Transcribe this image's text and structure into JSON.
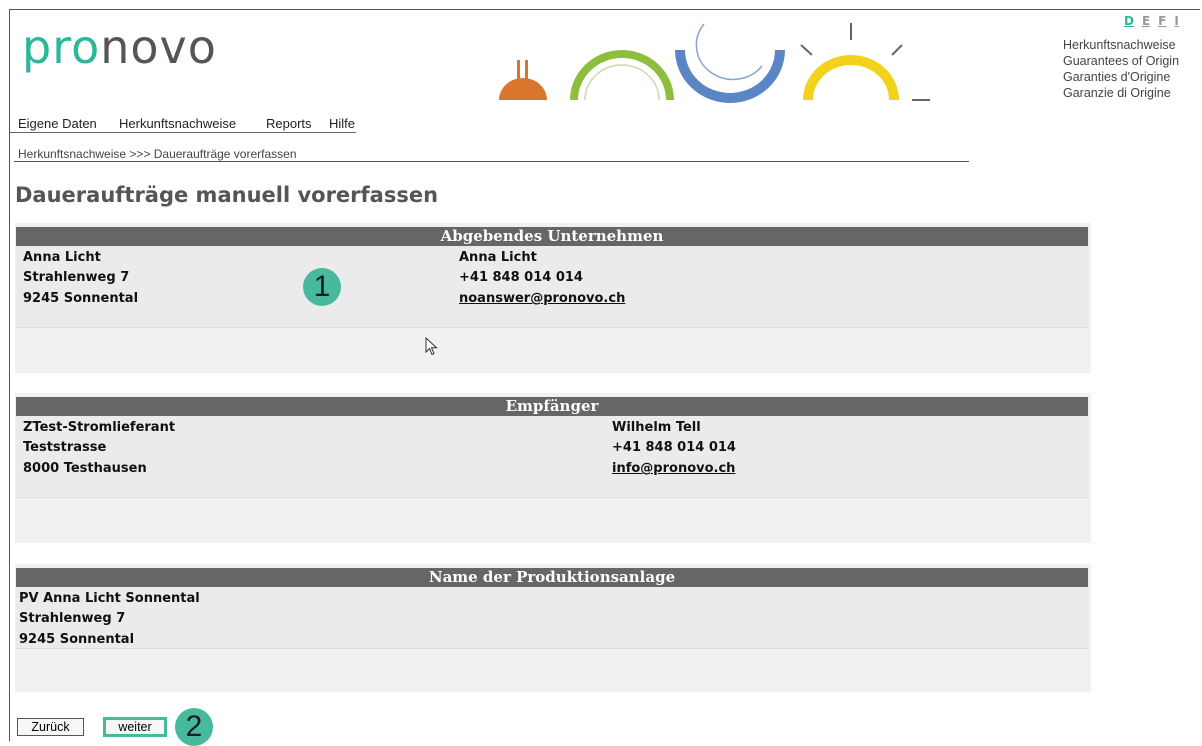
{
  "brand": {
    "logo_prefix": "pro",
    "logo_suffix": "novo",
    "accent_color": "#2cb79b"
  },
  "languages": [
    {
      "code": "D",
      "active": true
    },
    {
      "code": "E",
      "active": false
    },
    {
      "code": "F",
      "active": false
    },
    {
      "code": "I",
      "active": false
    }
  ],
  "tagline": [
    "Herkunftsnachweise",
    "Guarantees of Origin",
    "Garanties d'Origine",
    "Garanzie di Origine"
  ],
  "menu": [
    "Eigene Daten",
    "Herkunftsnachweise",
    "Reports",
    "Hilfe"
  ],
  "breadcrumb": "Herkunftsnachweise >>> Daueraufträge vorerfassen",
  "page_title": "Daueraufträge manuell vorerfassen",
  "sections": {
    "sender": {
      "header": "Abgebendes Unternehmen",
      "left": [
        "Anna Licht",
        "Strahlenweg 7",
        "9245 Sonnental"
      ],
      "contact_name": "Anna Licht",
      "contact_phone": "+41 848 014 014",
      "contact_email": "noanswer@pronovo.ch"
    },
    "recipient": {
      "header": "Empfänger",
      "left": [
        "ZTest-Stromlieferant",
        "Teststrasse",
        "8000 Testhausen"
      ],
      "contact_name": "Wilhelm Tell",
      "contact_phone": "+41 848 014 014",
      "contact_email": "info@pronovo.ch"
    },
    "plant": {
      "header": "Name der Produktionsanlage",
      "left": [
        "PV Anna Licht Sonnental",
        "Strahlenweg 7",
        "9245 Sonnental"
      ]
    }
  },
  "buttons": {
    "back": "Zurück",
    "next": "weiter"
  },
  "callouts": [
    "1",
    "2"
  ],
  "icons": [
    "hydro-icon",
    "arc-green-icon",
    "arc-blue-icon",
    "sun-icon",
    "mouse-cursor-icon"
  ]
}
